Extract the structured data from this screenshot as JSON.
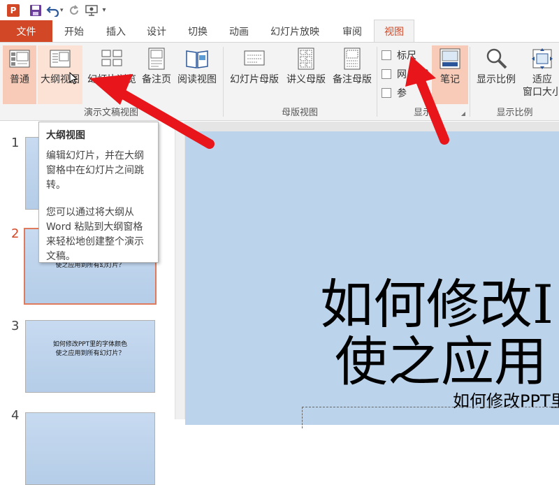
{
  "quick_access": {
    "logo_letter": "P",
    "items": [
      "ppt-logo-icon",
      "save-icon",
      "undo-icon",
      "undo-dropdown-icon",
      "redo-icon",
      "present-from-start-icon",
      "customize-toolbar-icon"
    ]
  },
  "tabs": [
    {
      "label": "文件"
    },
    {
      "label": "开始"
    },
    {
      "label": "插入"
    },
    {
      "label": "设计"
    },
    {
      "label": "切换"
    },
    {
      "label": "动画"
    },
    {
      "label": "幻灯片放映"
    },
    {
      "label": "审阅"
    },
    {
      "label": "视图"
    }
  ],
  "ribbon": {
    "presentation_views": {
      "label": "演示文稿视图",
      "label_visible": "演示文稿",
      "buttons": [
        {
          "label": "普通",
          "icon": "normal-view-icon",
          "state": "selected"
        },
        {
          "label": "大纲视图",
          "icon": "outline-view-icon",
          "state": "hover"
        },
        {
          "label": "幻灯片浏览",
          "icon": "slide-sorter-icon"
        },
        {
          "label": "备注页",
          "icon": "notes-page-icon"
        },
        {
          "label": "阅读视图",
          "icon": "reading-view-icon"
        }
      ]
    },
    "master_views": {
      "label": "母版视图",
      "buttons": [
        {
          "label": "幻灯片母版",
          "icon": "slide-master-icon"
        },
        {
          "label": "讲义母版",
          "icon": "handout-master-icon"
        },
        {
          "label": "备注母版",
          "icon": "notes-master-icon"
        }
      ]
    },
    "show": {
      "label": "显示",
      "checkboxes": [
        {
          "label": "标尺",
          "checked": false
        },
        {
          "label": "网格线",
          "label_visible": "网",
          "label_tail": "线",
          "checked": false
        },
        {
          "label": "参考线",
          "label_visible": "参",
          "checked": false
        }
      ],
      "notes_button": {
        "label": "笔记",
        "icon": "notes-icon",
        "state": "selected"
      }
    },
    "zoom": {
      "label": "显示比例",
      "buttons": [
        {
          "label": "显示比例",
          "icon": "zoom-icon"
        },
        {
          "label": "适应\n窗口大小",
          "line1": "适应",
          "line2": "窗口大小",
          "icon": "fit-to-window-icon"
        }
      ]
    }
  },
  "tooltip": {
    "title": "大纲视图",
    "para1": "编辑幻灯片，并在大纲窗格中在幻灯片之间跳转。",
    "para2": "您可以通过将大纲从 Word 粘贴到大纲窗格来轻松地创建整个演示文稿。"
  },
  "slide_panel": {
    "slides": [
      {
        "number": "1",
        "text": ""
      },
      {
        "number": "2",
        "text": "使之应用到所有幻灯片？",
        "current": true
      },
      {
        "number": "3",
        "text_line1": "如何修改PPT里的字体颜色",
        "text_line2": "使之应用到所有幻灯片？"
      },
      {
        "number": "4",
        "text": ""
      }
    ]
  },
  "main_slide": {
    "title_line1": "如何修改I",
    "title_line2": "使之应用",
    "subtitle": "如何修改PPT里",
    "background": "#bcd3ec"
  },
  "colors": {
    "accent": "#d24726",
    "ribbon_bg": "#f3f3f3",
    "selected_bg": "#f7cbb7",
    "arrow_red": "#e8161a"
  }
}
